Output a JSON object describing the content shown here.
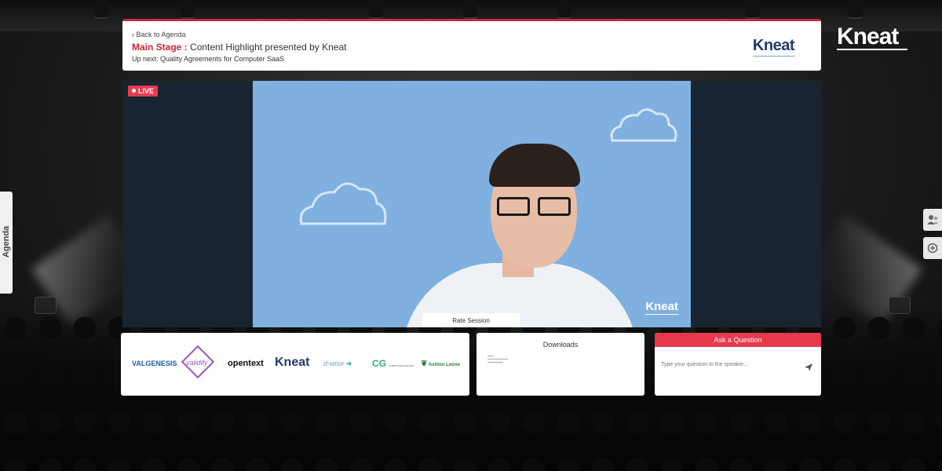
{
  "brand": {
    "name": "Kneat"
  },
  "header": {
    "back_label": "‹ Back to Agenda",
    "stage_label": "Main Stage :",
    "stage_title": " Content Highlight presented by Kneat",
    "up_next": "Up next: Quality Agreements for Computer SaaS",
    "logo": "Kneat"
  },
  "video": {
    "live_label": "LIVE",
    "overlay_logo": "Kneat",
    "rate_label": "Rate Session"
  },
  "agenda": {
    "label": "Agenda"
  },
  "side_buttons": [
    {
      "icon": "attendees-icon"
    },
    {
      "icon": "chat-icon"
    }
  ],
  "sponsors": [
    {
      "name": "VALGENESIS",
      "color": "#1c5fa8"
    },
    {
      "name": "validify",
      "color": "#9b59b6"
    },
    {
      "name": "opentext",
      "color": "#111111"
    },
    {
      "name": "Kneat",
      "color": "#233a6b"
    },
    {
      "name": "d-wise",
      "color": "#7aa3b8"
    },
    {
      "name": "COMPLIANCE GROUP",
      "color": "#2eae7a"
    },
    {
      "name": "Ashton Leone",
      "color": "#2a7a3a"
    }
  ],
  "downloads": {
    "title": "Downloads"
  },
  "ask": {
    "title": "Ask a Question",
    "placeholder": "Type your question to the speaker..."
  },
  "colors": {
    "accent": "#e63a4c",
    "brand_navy": "#233a6b",
    "stage_blue": "#7fb0e0"
  }
}
